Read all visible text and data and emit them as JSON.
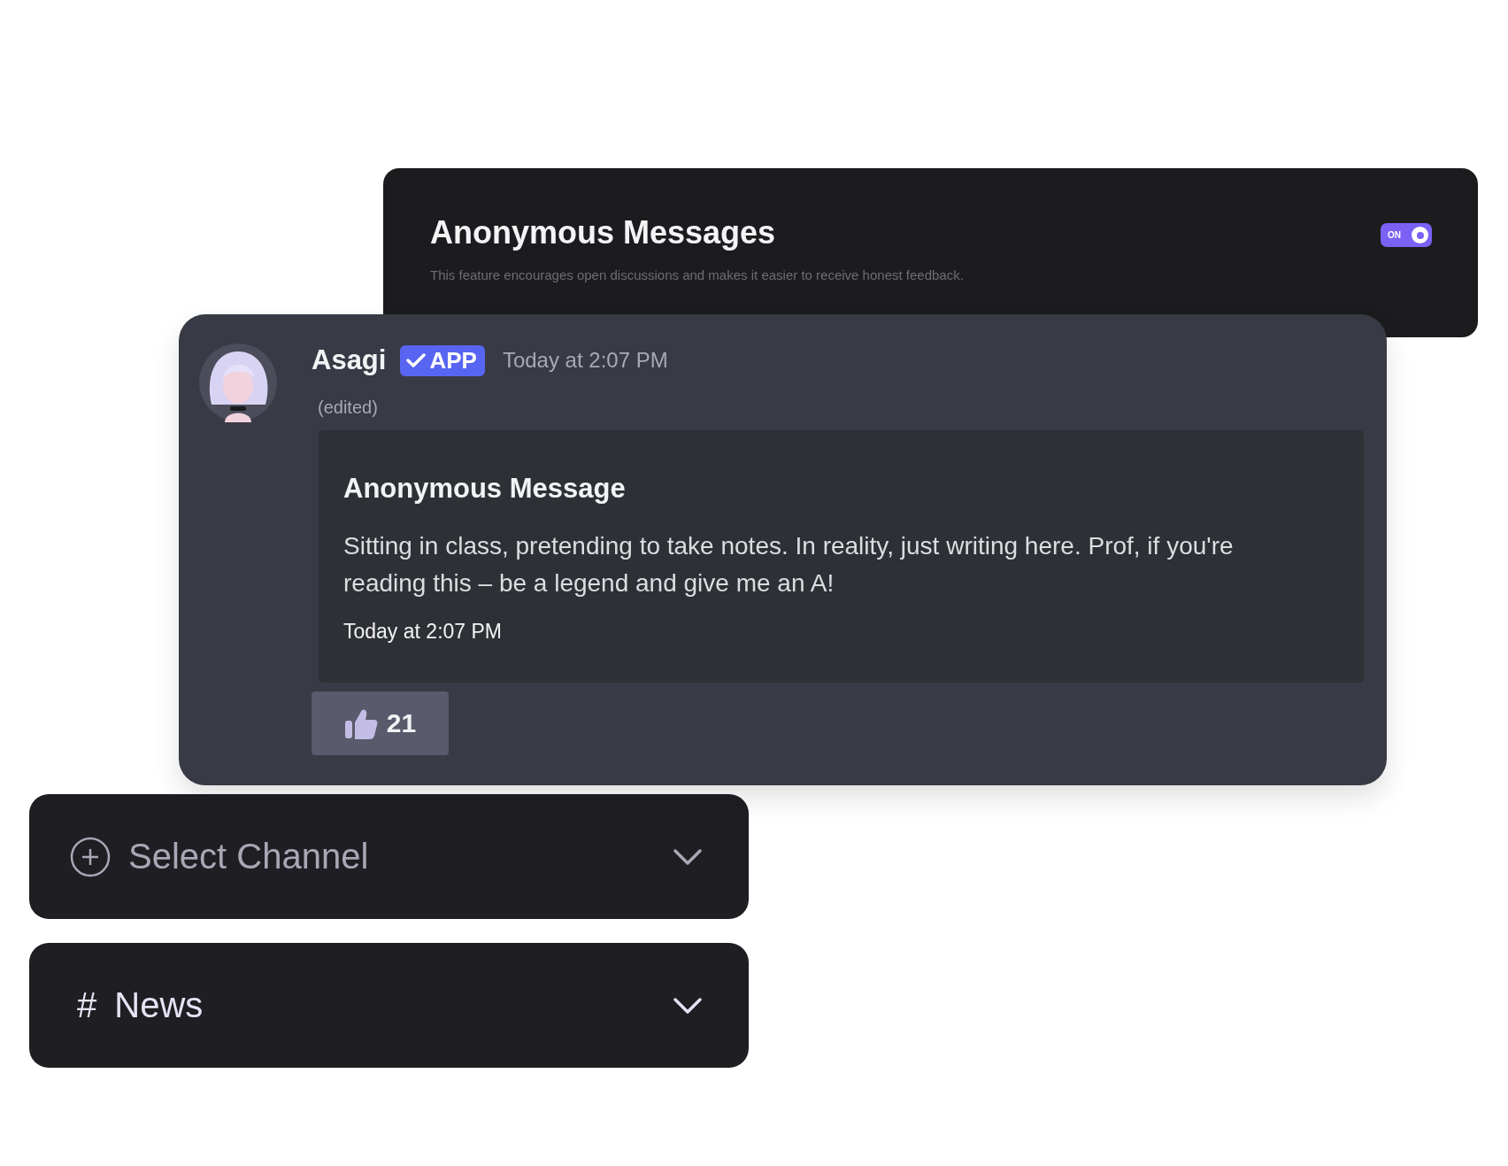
{
  "settings_card": {
    "title": "Anonymous Messages",
    "description": "This feature encourages open discussions and makes it easier to receive honest feedback.",
    "toggle": {
      "label": "ON",
      "on": true
    }
  },
  "message": {
    "author": "Asagi",
    "badge": {
      "label": "APP",
      "verified": true
    },
    "timestamp": "Today at 2:07 PM",
    "edited": "(edited)",
    "embed": {
      "title": "Anonymous Message",
      "body": "Sitting in class, pretending to take notes. In reality, just writing here. Prof, if you're reading this – be a legend and give me an A!",
      "timestamp": "Today at 2:07 PM"
    },
    "reactions": [
      {
        "count": "21"
      }
    ]
  },
  "channel_selects": [
    {
      "kind": "placeholder",
      "label": "Select Channel"
    },
    {
      "kind": "channel",
      "prefix": "#",
      "label": "News"
    }
  ]
}
